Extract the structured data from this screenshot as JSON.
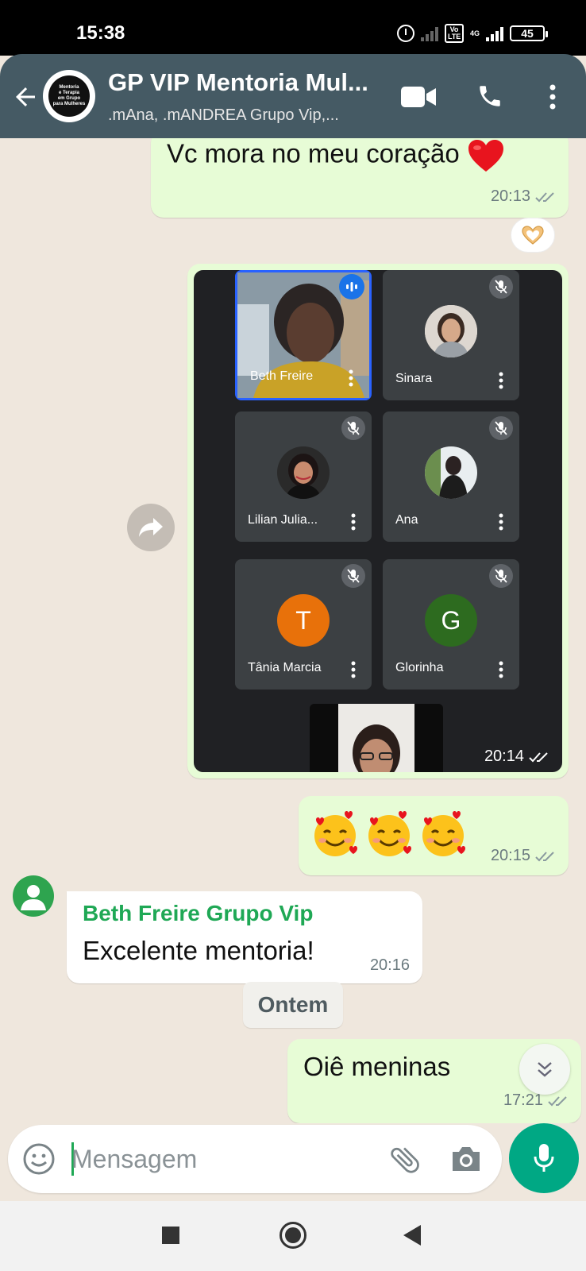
{
  "status_bar": {
    "time": "15:38",
    "volte": "Vo LTE",
    "network": "4G",
    "battery": "45"
  },
  "header": {
    "title": "GP VIP Mentoria Mul...",
    "subtitle": ".mAna, .mANDREA Grupo Vip,...",
    "avatar_lines": [
      "Mentoria",
      "e Terapia",
      "em Grupo",
      "para Mulheres"
    ]
  },
  "messages": [
    {
      "id": "m1",
      "direction": "out",
      "text": "Vc mora no meu coração",
      "emoji": "heart",
      "time": "20:13",
      "status": "delivered",
      "reaction": "heart-hands"
    },
    {
      "id": "m2",
      "direction": "out",
      "type": "image",
      "time": "20:14",
      "status": "delivered",
      "image": {
        "tiles": [
          {
            "name": "Beth Freire",
            "speaking": true
          },
          {
            "name": "Sinara",
            "muted": true
          },
          {
            "name": "Lilian Julia...",
            "muted": true
          },
          {
            "name": "Ana",
            "muted": true
          },
          {
            "name": "Tânia Marcia",
            "muted": true,
            "initial": "T",
            "color": "#e8710a"
          },
          {
            "name": "Glorinha",
            "muted": true,
            "initial": "G",
            "color": "#2d6b1f"
          }
        ]
      }
    },
    {
      "id": "m3",
      "direction": "out",
      "emoji_only": "🥰🥰🥰",
      "time": "20:15",
      "status": "delivered"
    },
    {
      "id": "m4",
      "direction": "in",
      "sender": "Beth Freire Grupo Vip",
      "text": "Excelente mentoria!",
      "time": "20:16"
    },
    {
      "id": "m5",
      "direction": "out",
      "text": "Oiê meninas",
      "time": "17:21",
      "status": "delivered"
    }
  ],
  "date_separator": "Ontem",
  "composer": {
    "placeholder": "Mensagem"
  },
  "colors": {
    "header": "#455a64",
    "outgoing_bubble": "#e7fcd6",
    "incoming_bubble": "#ffffff",
    "accent_green": "#00a884",
    "sender_name": "#1fa855",
    "chat_background": "#efe7dd"
  }
}
